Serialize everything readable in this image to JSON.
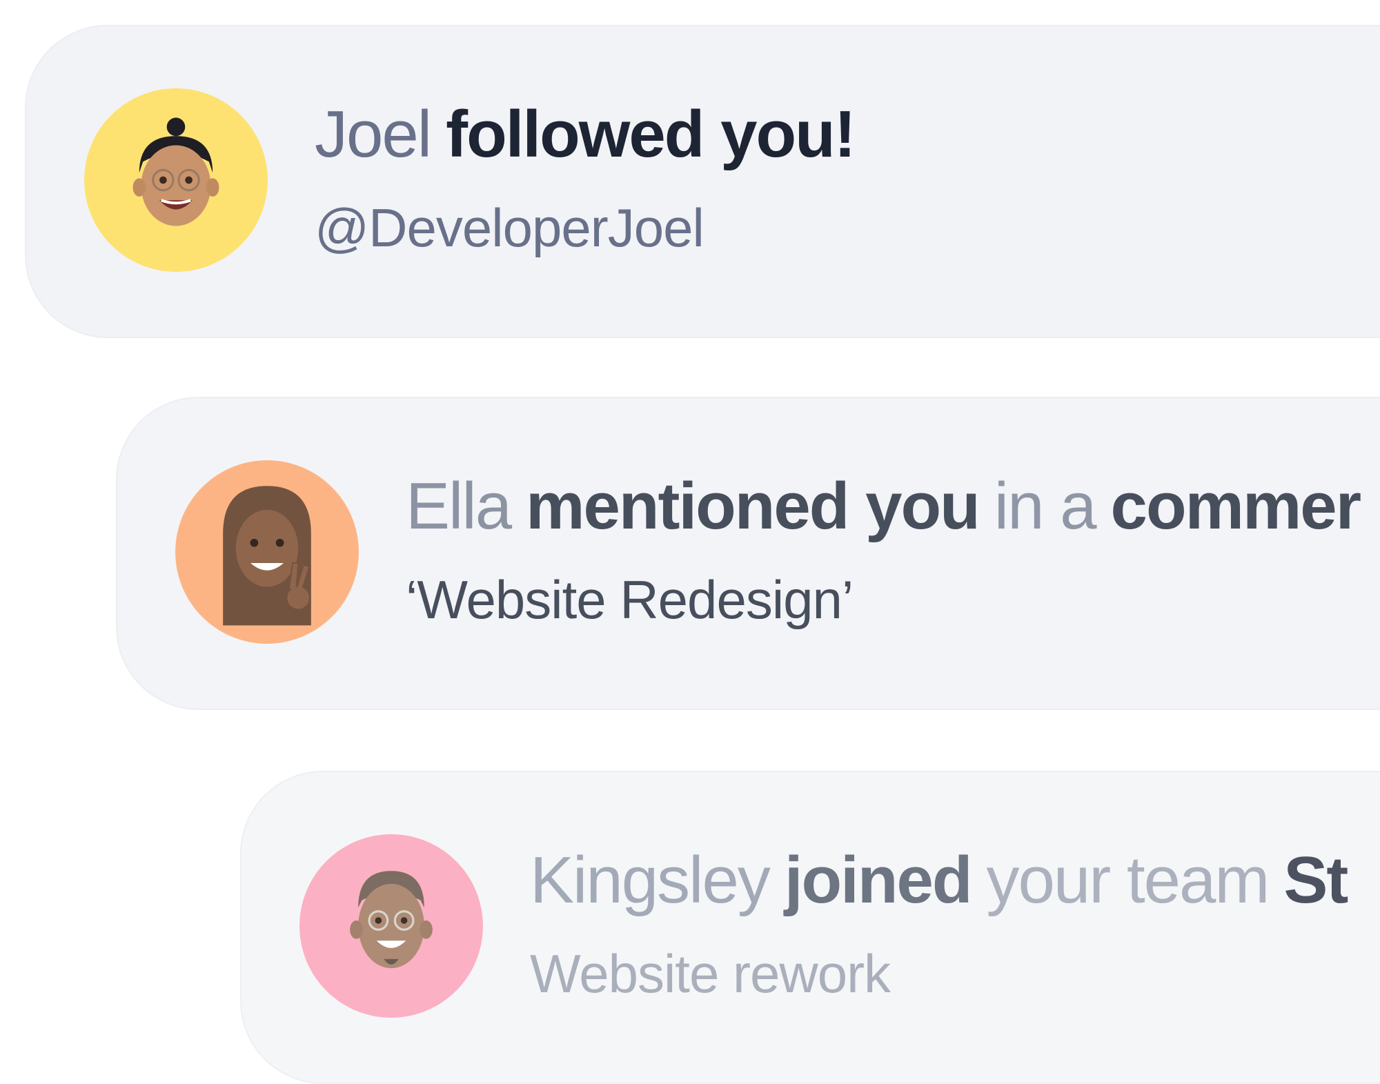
{
  "notifications": [
    {
      "avatar": {
        "icon": "memoji-man-bun-glasses-icon",
        "bg": "#FDE272"
      },
      "name": "Joel",
      "action": "followed you!",
      "detail": "@DeveloperJoel"
    },
    {
      "avatar": {
        "icon": "memoji-woman-peace-sign-icon",
        "bg": "#FDB07E"
      },
      "name": "Ella",
      "action": "mentioned you",
      "connector": "in a",
      "object": "commer",
      "detail": "‘Website Redesign’"
    },
    {
      "avatar": {
        "icon": "memoji-man-goatee-glasses-icon",
        "bg": "#FCA8BD"
      },
      "name": "Kingsley",
      "action": "joined",
      "connector": "your team",
      "object": "St",
      "detail": "Website rework"
    }
  ]
}
